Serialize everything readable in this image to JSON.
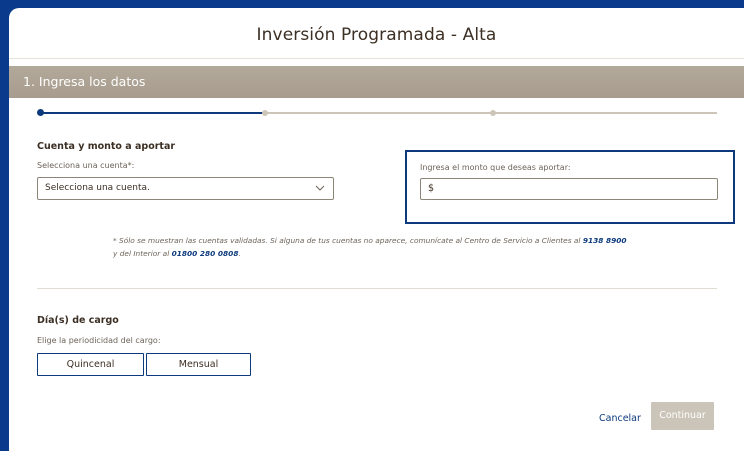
{
  "page": {
    "title": "Inversión Programada - Alta"
  },
  "section": {
    "label": "1. Ingresa los datos"
  },
  "stepper": {
    "current_step": 1,
    "total_steps": 3
  },
  "account_block": {
    "heading": "Cuenta y monto a aportar",
    "select_label": "Selecciona una cuenta*:",
    "select_value": "Selecciona una cuenta.",
    "amount_label": "Ingresa el monto que deseas aportar:",
    "amount_value": "$"
  },
  "note": {
    "text_1": "* Sólo se muestran las cuentas validadas. Si alguna de tus cuentas no aparece, comunícate al Centro de Servicio a Clientes al ",
    "phone_1": "9138 8900",
    "text_2": "y del Interior al ",
    "phone_2": "01800 280 0808",
    "text_3": "."
  },
  "charge_days": {
    "heading": "Día(s) de cargo",
    "label": "Elige la periodicidad del cargo:",
    "options": [
      "Quincenal",
      "Mensual"
    ]
  },
  "actions": {
    "cancel": "Cancelar",
    "continue": "Continuar"
  },
  "colors": {
    "frame": "#0a3a8c",
    "accent": "#0c3a7d",
    "section_bar": "#a89d8e",
    "disabled": "#cbc4b8"
  },
  "icons": {
    "select_arrow": "chevron-down-icon"
  }
}
